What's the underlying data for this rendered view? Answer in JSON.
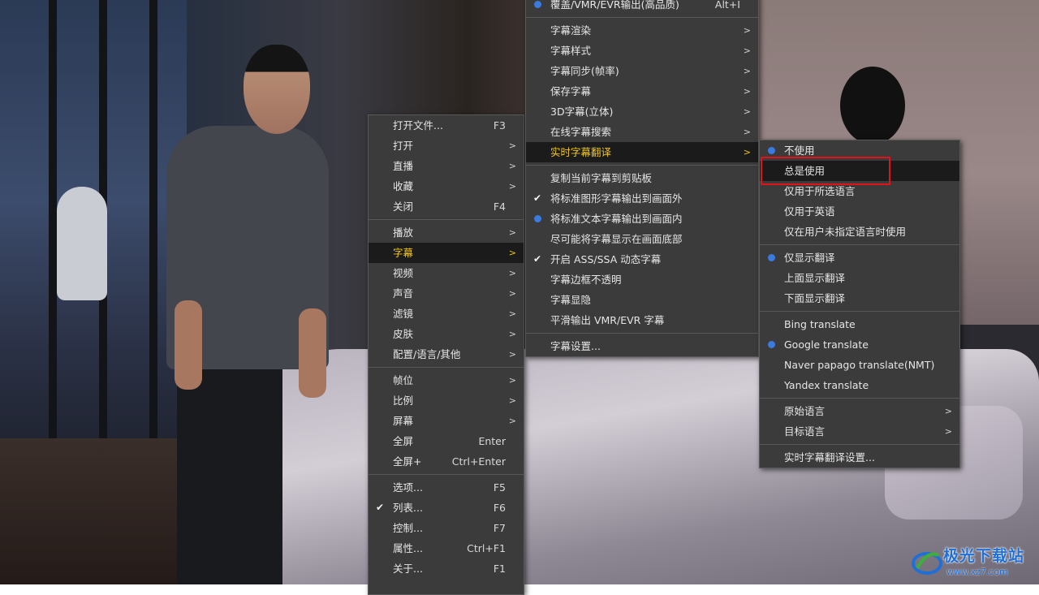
{
  "main_menu": {
    "groups": [
      [
        {
          "label": "打开文件...",
          "shortcut": "F3",
          "submenu": false
        },
        {
          "label": "打开",
          "shortcut": "",
          "submenu": true
        },
        {
          "label": "直播",
          "shortcut": "",
          "submenu": true
        },
        {
          "label": "收藏",
          "shortcut": "",
          "submenu": true
        },
        {
          "label": "关闭",
          "shortcut": "F4",
          "submenu": false
        }
      ],
      [
        {
          "label": "播放",
          "shortcut": "",
          "submenu": true
        },
        {
          "label": "字幕",
          "shortcut": "",
          "submenu": true,
          "state": "active"
        },
        {
          "label": "视频",
          "shortcut": "",
          "submenu": true
        },
        {
          "label": "声音",
          "shortcut": "",
          "submenu": true
        },
        {
          "label": "滤镜",
          "shortcut": "",
          "submenu": true
        },
        {
          "label": "皮肤",
          "shortcut": "",
          "submenu": true
        },
        {
          "label": "配置/语言/其他",
          "shortcut": "",
          "submenu": true
        }
      ],
      [
        {
          "label": "帧位",
          "shortcut": "",
          "submenu": true
        },
        {
          "label": "比例",
          "shortcut": "",
          "submenu": true
        },
        {
          "label": "屏幕",
          "shortcut": "",
          "submenu": true
        },
        {
          "label": "全屏",
          "shortcut": "Enter",
          "submenu": false
        },
        {
          "label": "全屏+",
          "shortcut": "Ctrl+Enter",
          "submenu": false
        }
      ],
      [
        {
          "label": "选项...",
          "shortcut": "F5",
          "submenu": false
        },
        {
          "label": "列表...",
          "shortcut": "F6",
          "submenu": false,
          "mark": "check"
        },
        {
          "label": "控制...",
          "shortcut": "F7",
          "submenu": false
        },
        {
          "label": "属性...",
          "shortcut": "Ctrl+F1",
          "submenu": false
        },
        {
          "label": "关于...",
          "shortcut": "F1",
          "submenu": false
        }
      ]
    ]
  },
  "subtitle_menu": {
    "groups": [
      [
        {
          "label": "覆盖/VMR/EVR输出(高品质)",
          "shortcut": "Alt+I",
          "submenu": false,
          "mark": "dot"
        }
      ],
      [
        {
          "label": "字幕渲染",
          "shortcut": "",
          "submenu": true
        },
        {
          "label": "字幕样式",
          "shortcut": "",
          "submenu": true
        },
        {
          "label": "字幕同步(帧率)",
          "shortcut": "",
          "submenu": true
        },
        {
          "label": "保存字幕",
          "shortcut": "",
          "submenu": true
        },
        {
          "label": "3D字幕(立体)",
          "shortcut": "",
          "submenu": true
        },
        {
          "label": "在线字幕搜索",
          "shortcut": "",
          "submenu": true
        },
        {
          "label": "实时字幕翻译",
          "shortcut": "",
          "submenu": true,
          "state": "active"
        }
      ],
      [
        {
          "label": "复制当前字幕到剪贴板",
          "shortcut": "",
          "submenu": false
        },
        {
          "label": "将标准图形字幕输出到画面外",
          "shortcut": "",
          "submenu": false,
          "mark": "check"
        },
        {
          "label": "将标准文本字幕输出到画面内",
          "shortcut": "",
          "submenu": false,
          "mark": "dot"
        },
        {
          "label": "尽可能将字幕显示在画面底部",
          "shortcut": "",
          "submenu": false
        },
        {
          "label": "开启 ASS/SSA 动态字幕",
          "shortcut": "",
          "submenu": false,
          "mark": "check"
        },
        {
          "label": "字幕边框不透明",
          "shortcut": "",
          "submenu": false
        },
        {
          "label": "字幕显隐",
          "shortcut": "",
          "submenu": false
        },
        {
          "label": "平滑输出 VMR/EVR 字幕",
          "shortcut": "",
          "submenu": false
        }
      ],
      [
        {
          "label": "字幕设置...",
          "shortcut": "",
          "submenu": false
        }
      ]
    ]
  },
  "translate_menu": {
    "groups": [
      [
        {
          "label": "不使用",
          "shortcut": "",
          "submenu": false,
          "mark": "dot"
        },
        {
          "label": "总是使用",
          "shortcut": "",
          "submenu": false,
          "state": "hovered"
        },
        {
          "label": "仅用于所选语言",
          "shortcut": "",
          "submenu": false
        },
        {
          "label": "仅用于英语",
          "shortcut": "",
          "submenu": false
        },
        {
          "label": "仅在用户未指定语言时使用",
          "shortcut": "",
          "submenu": false
        }
      ],
      [
        {
          "label": "仅显示翻译",
          "shortcut": "",
          "submenu": false,
          "mark": "dot"
        },
        {
          "label": "上面显示翻译",
          "shortcut": "",
          "submenu": false
        },
        {
          "label": "下面显示翻译",
          "shortcut": "",
          "submenu": false
        }
      ],
      [
        {
          "label": "Bing translate",
          "shortcut": "",
          "submenu": false
        },
        {
          "label": "Google translate",
          "shortcut": "",
          "submenu": false,
          "mark": "dot"
        },
        {
          "label": "Naver papago translate(NMT)",
          "shortcut": "",
          "submenu": false
        },
        {
          "label": "Yandex translate",
          "shortcut": "",
          "submenu": false
        }
      ],
      [
        {
          "label": "原始语言",
          "shortcut": "",
          "submenu": true
        },
        {
          "label": "目标语言",
          "shortcut": "",
          "submenu": true
        }
      ],
      [
        {
          "label": "实时字幕翻译设置...",
          "shortcut": "",
          "submenu": false
        }
      ]
    ]
  },
  "submenu_arrow": ">",
  "check_glyph": "✔",
  "watermark": {
    "title": "极光下载站",
    "url": "www.xz7.com"
  },
  "colors": {
    "menu_bg": "#3b3b3b",
    "active_text": "#f0c419",
    "radio_dot": "#3b7be0",
    "highlight_box": "#e2121b"
  }
}
